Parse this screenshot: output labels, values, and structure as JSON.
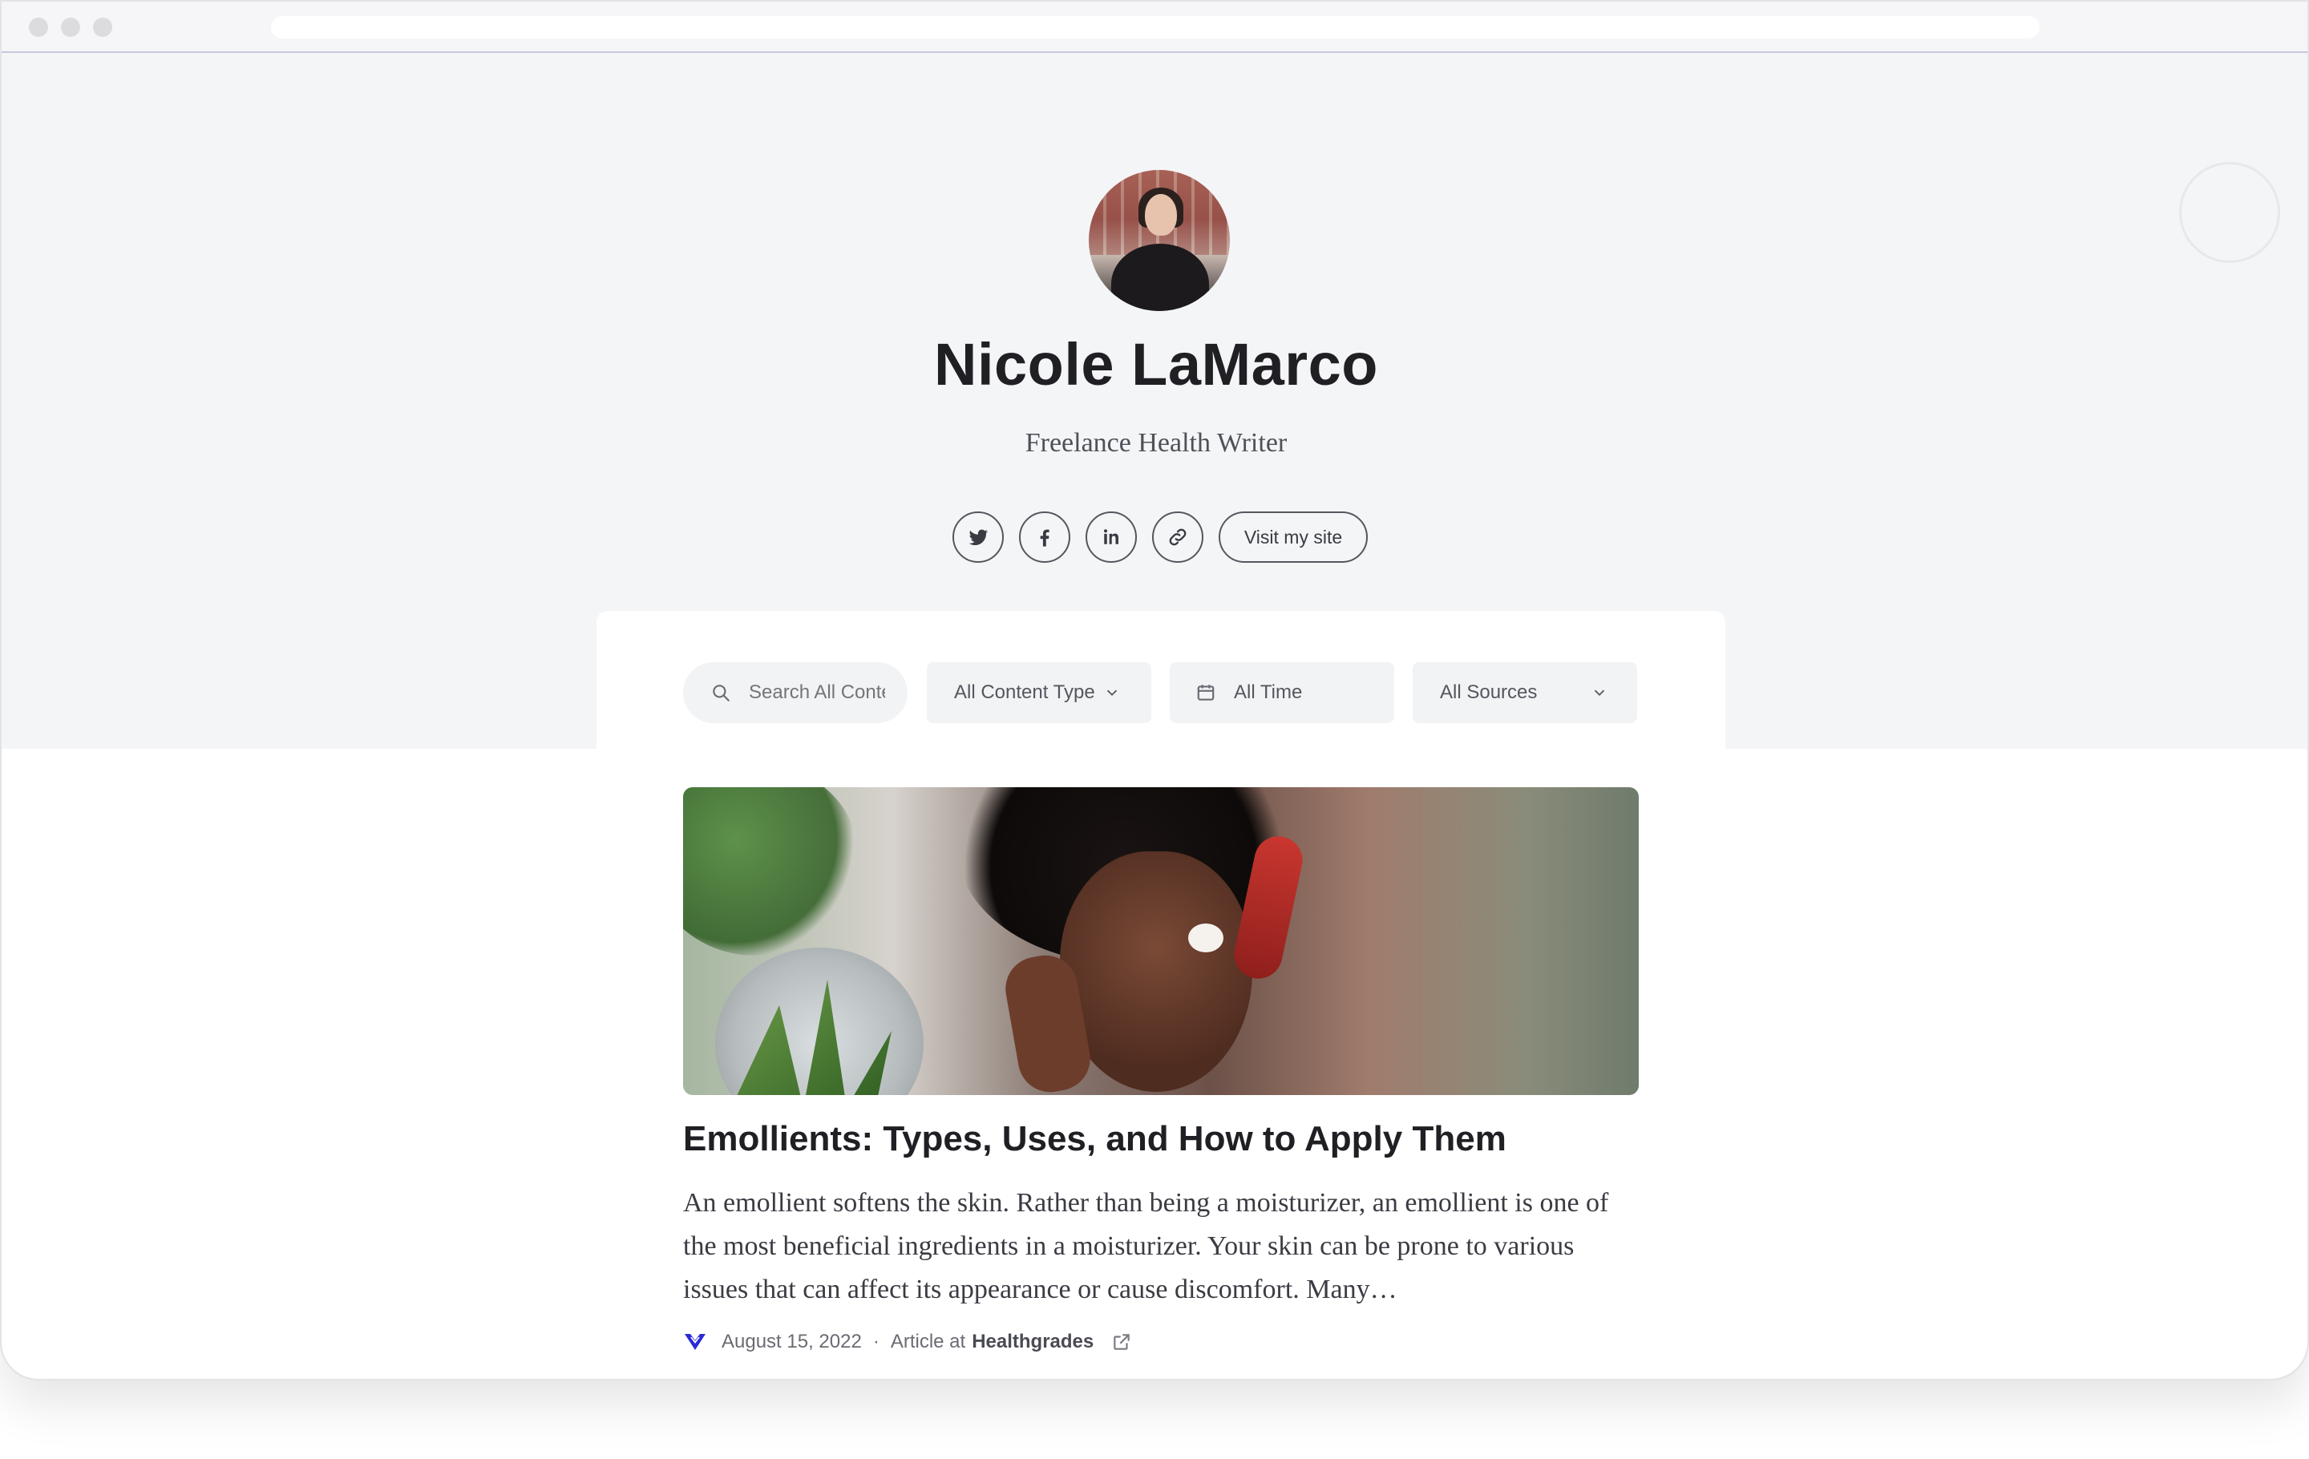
{
  "browser": {
    "url": ""
  },
  "profile": {
    "name": "Nicole LaMarco",
    "tagline": "Freelance Health Writer",
    "visit_label": "Visit my site"
  },
  "social": [
    {
      "icon": "twitter-icon"
    },
    {
      "icon": "facebook-icon"
    },
    {
      "icon": "linkedin-icon"
    },
    {
      "icon": "link-icon"
    }
  ],
  "filters": {
    "search_placeholder": "Search All Content",
    "content_type": "All Content Types",
    "time": "All Time",
    "sources": "All Sources"
  },
  "article": {
    "title": "Emollients: Types, Uses, and How to Apply Them",
    "excerpt": "An emollient softens the skin. Rather than being a moisturizer, an emollient is one of the most beneficial ingredients in a moisturizer. Your skin can be prone to various issues that can affect its appearance or cause discomfort. Many…",
    "date": "August 15, 2022",
    "separator": "·",
    "type_prefix": "Article at",
    "source": "Healthgrades"
  },
  "colors": {
    "hero_bg": "#f4f5f7",
    "text_dark": "#1f1f24",
    "source_logo": "#2b2bd6"
  }
}
